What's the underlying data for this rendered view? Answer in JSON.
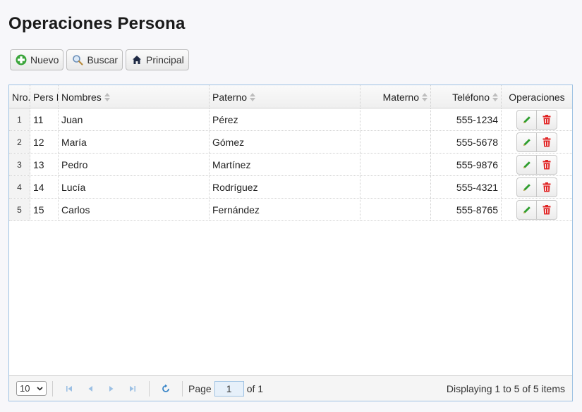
{
  "page": {
    "title": "Operaciones Persona"
  },
  "toolbar": {
    "nuevo": {
      "label": "Nuevo",
      "icon": "plus-icon"
    },
    "buscar": {
      "label": "Buscar",
      "icon": "search-icon"
    },
    "principal": {
      "label": "Principal",
      "icon": "home-icon"
    }
  },
  "grid": {
    "columns": [
      "Nro.",
      "Pers Id",
      "Nombres",
      "Paterno",
      "Materno",
      "Teléfono",
      "Operaciones"
    ],
    "rows": [
      {
        "nro": "1",
        "id": "11",
        "nombres": "Juan",
        "paterno": "Pérez",
        "materno": "",
        "telefono": "555-1234"
      },
      {
        "nro": "2",
        "id": "12",
        "nombres": "María",
        "paterno": "Gómez",
        "materno": "",
        "telefono": "555-5678"
      },
      {
        "nro": "3",
        "id": "13",
        "nombres": "Pedro",
        "paterno": "Martínez",
        "materno": "",
        "telefono": "555-9876"
      },
      {
        "nro": "4",
        "id": "14",
        "nombres": "Lucía",
        "paterno": "Rodríguez",
        "materno": "",
        "telefono": "555-4321"
      },
      {
        "nro": "5",
        "id": "15",
        "nombres": "Carlos",
        "paterno": "Fernández",
        "materno": "",
        "telefono": "555-8765"
      }
    ]
  },
  "pager": {
    "page_size": "10",
    "page_label": "Page",
    "page_value": "1",
    "of_label": "of 1",
    "info": "Displaying 1 to 5 of 5 items"
  },
  "colors": {
    "accent_border": "#9ec2e3",
    "edit_green": "#2e9e2e",
    "delete_red": "#e02424",
    "add_green": "#3aa53a"
  }
}
